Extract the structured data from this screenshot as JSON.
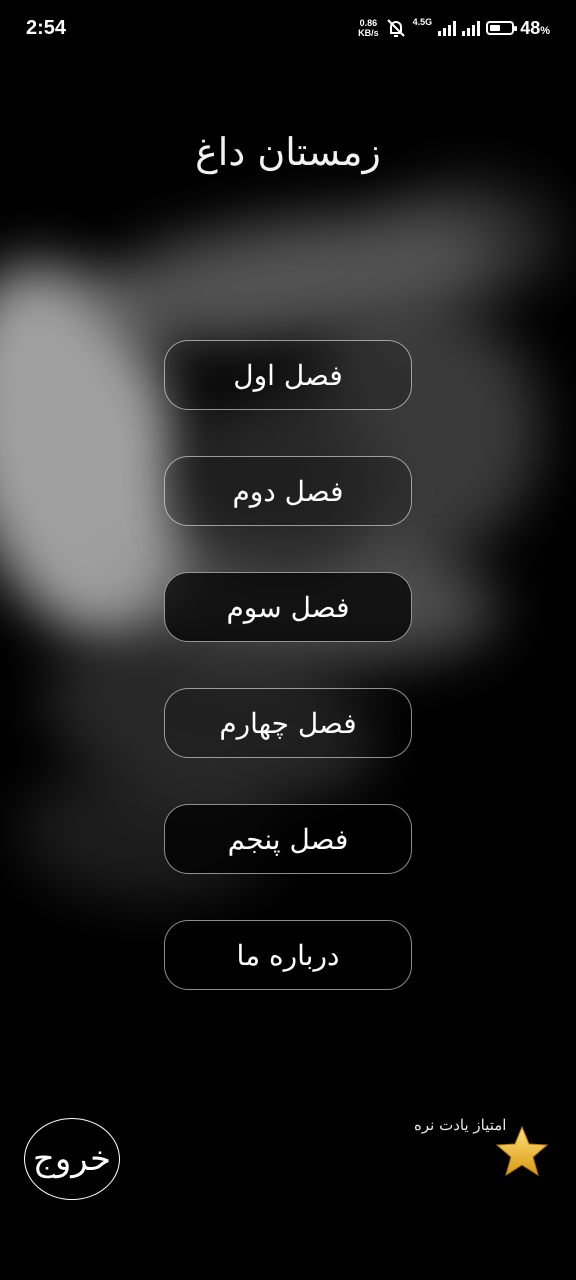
{
  "status_bar": {
    "time": "2:54",
    "net_speed_value": "0.86",
    "net_speed_unit": "KB/s",
    "network_type": "4.5G",
    "battery_percent": "48",
    "battery_percent_sign": "%",
    "battery_level": 0.48
  },
  "title": "زمستان داغ",
  "menu": {
    "items": [
      {
        "label": "فصل اول"
      },
      {
        "label": "فصل دوم"
      },
      {
        "label": "فصل سوم"
      },
      {
        "label": "فصل چهارم"
      },
      {
        "label": "فصل پنجم"
      },
      {
        "label": "درباره ما"
      }
    ]
  },
  "exit_label": "خروج",
  "rate_label": "امتیاز یادت نره",
  "icons": {
    "rate": "star-icon",
    "mute": "muted-bell-icon",
    "signal": "signal-icon",
    "battery": "battery-icon"
  },
  "colors": {
    "background": "#000000",
    "text": "#ffffff",
    "star": "#f0b429"
  }
}
